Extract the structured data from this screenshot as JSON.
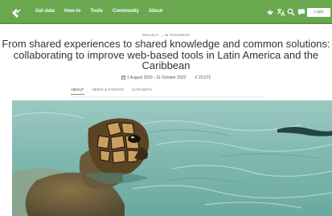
{
  "nav": {
    "links": [
      "Get data",
      "How-to",
      "Tools",
      "Community",
      "About"
    ],
    "login_label": "Login"
  },
  "project": {
    "tag_project": "PROJECT",
    "tag_status": "IN PROGRESS",
    "title": "From shared experiences to shared knowledge and common solutions: collaborating to improve web-based tools in Latin America and the Caribbean",
    "dates": "1 August 2020 - 31 October 2022",
    "budget": "€ 23,072"
  },
  "tabs": [
    "ABOUT",
    "NEWS & EVENTS",
    "DATASETS"
  ],
  "colors": {
    "header": "#6aa84f",
    "water": "#7fb8b0"
  },
  "icons": [
    "logo-icon",
    "accessibility-icon",
    "translate-icon",
    "search-icon",
    "chat-icon",
    "calendar-icon"
  ]
}
